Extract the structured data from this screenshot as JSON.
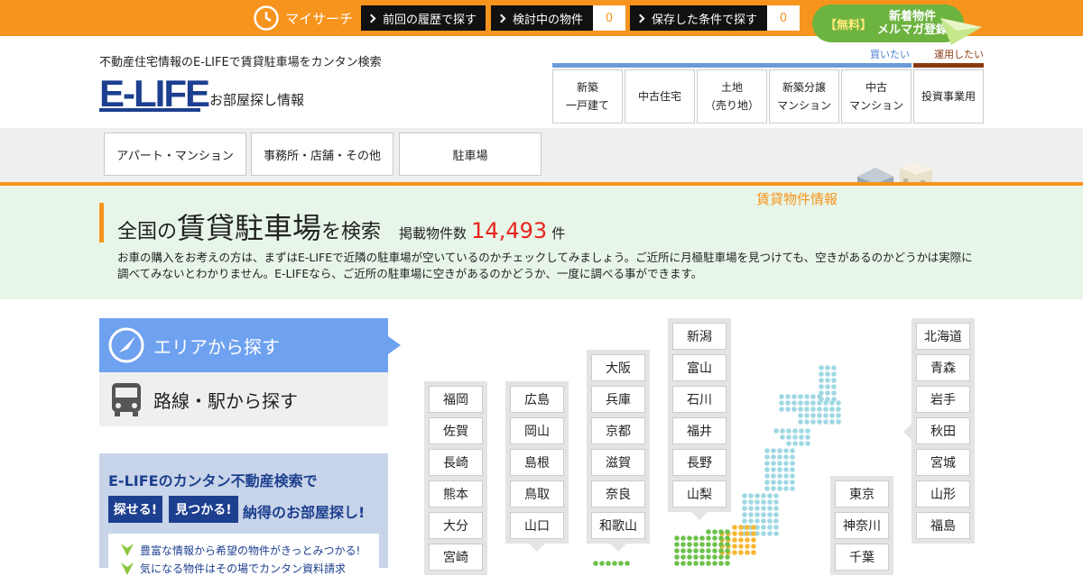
{
  "topbar": {
    "mysearch_label": "マイサーチ",
    "history_label": "前回の履歴で探す",
    "considering_label": "検討中の物件",
    "considering_count": "0",
    "saved_label": "保存した条件で探す",
    "saved_count": "0",
    "mail_tag": "【無料】",
    "mail_line1": "新着物件",
    "mail_line2": "メルマガ登録",
    "accent_color": "#f7941d"
  },
  "header": {
    "tagline": "不動産住宅情報のE-LIFEで賃貸駐車場をカンタン検索",
    "logo": "E-LIFE",
    "logo_sub": "お部屋探し情報",
    "buy_label": "買いたい",
    "invest_label": "運用したい",
    "categories": [
      "新築\n一戸建て",
      "中古住宅",
      "土地\n（売り地）",
      "新築分譲\nマンション",
      "中古\nマンション",
      "投資事業用"
    ]
  },
  "subnav": {
    "tabs": [
      "アパート・マンション",
      "事務所・店舗・その他",
      "駐車場"
    ]
  },
  "banner": {
    "label": "賃貸物件情報",
    "title_a": "全国の",
    "title_b": "賃貸駐車場",
    "title_c": "を検索",
    "count_label": "掲載物件数",
    "count": "14,493",
    "count_unit": "件",
    "description": "お車の購入をお考えの方は、まずはE-LIFEで近隣の駐車場が空いているのかチェックしてみましょう。ご近所に月極駐車場を見つけても、空きがあるのかどうかは実際に調べてみないとわかりません。E-LIFEなら、ご近所の駐車場に空きがあるのかどうか、一度に調べる事ができます。"
  },
  "search_tabs": {
    "area": "エリアから探す",
    "line": "路線・駅から探す"
  },
  "promo": {
    "heading": "E-LIFEのカンタン不動産検索で",
    "tag1": "探せる!",
    "tag2": "見つかる!",
    "heading2": "納得のお部屋探し!",
    "item1": "豊富な情報から希望の物件がきっとみつかる!",
    "item2": "気になる物件はその場でカンタン資料請求"
  },
  "regions": {
    "kyushu": [
      "福岡",
      "佐賀",
      "長崎",
      "熊本",
      "大分",
      "宮崎"
    ],
    "chugoku": [
      "広島",
      "岡山",
      "島根",
      "鳥取",
      "山口"
    ],
    "kinki": [
      "大阪",
      "兵庫",
      "京都",
      "滋賀",
      "奈良",
      "和歌山"
    ],
    "koshinetsu": [
      "新潟",
      "富山",
      "石川",
      "福井",
      "長野",
      "山梨"
    ],
    "kanto": [
      "東京",
      "神奈川",
      "千葉"
    ],
    "tohoku": [
      "北海道",
      "青森",
      "岩手",
      "秋田",
      "宮城",
      "山形",
      "福島"
    ]
  }
}
